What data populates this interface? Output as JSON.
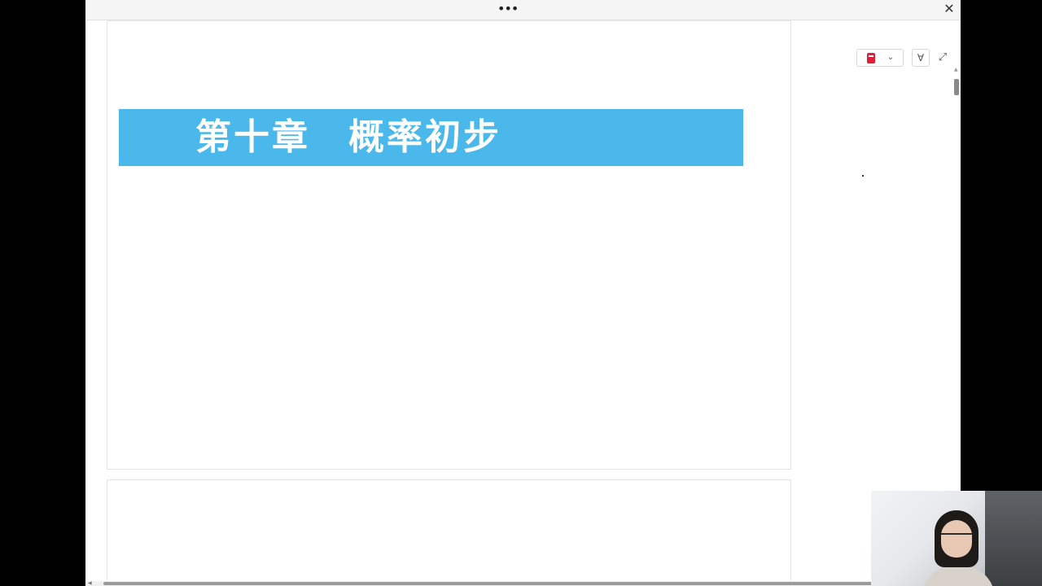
{
  "window": {
    "more_menu_glyph": "•••",
    "close_glyph": "✕"
  },
  "document": {
    "chapter_title": "第十章　概率初步",
    "banner_color": "#4ab8ea"
  },
  "toolbar": {
    "book_icon": "book-icon",
    "dropdown_glyph": "⌄",
    "filter_glyph": "∀",
    "expand_glyph": "⤢"
  },
  "colors": {
    "accent_red": "#e0203a",
    "background": "#ffffff"
  }
}
